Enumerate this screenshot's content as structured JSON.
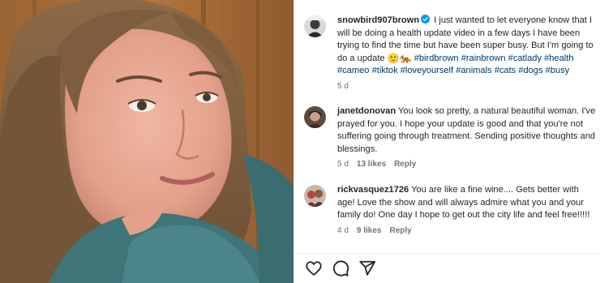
{
  "caption": {
    "username": "snowbird907brown",
    "text": "I just wanted to let everyone know that I will be doing a health update video in a few days I have been trying to find the time but have been super busy. But I'm going to do a update",
    "emojis": [
      "🙂",
      "🐅"
    ],
    "hashtags": [
      "#birdbrown",
      "#rainbrown",
      "#catlady",
      "#health",
      "#cameo",
      "#tiktok",
      "#loveyourself",
      "#animals",
      "#cats",
      "#dogs",
      "#busy"
    ],
    "time": "5 d"
  },
  "comments": [
    {
      "username": "janetdonovan",
      "text": "You look so pretty, a natural beautiful woman. I've prayed for you. I hope your update is good and that you're not suffering going through treatment. Sending positive thoughts and blessings.",
      "time": "5 d",
      "likes": "13 likes",
      "reply": "Reply"
    },
    {
      "username": "rickvasquez1726",
      "text": "You are like a fine wine.... Gets better with age! Love the show and will always admire what you and your family do! One day I hope to get out the city life and feel free!!!!!",
      "time": "4 d",
      "likes": "9 likes",
      "reply": "Reply"
    }
  ],
  "actions": {
    "like_icon": "heart-icon",
    "comment_icon": "comment-icon",
    "share_icon": "share-icon"
  },
  "colors": {
    "hashtag": "#00376b",
    "meta": "#737373",
    "verified": "#0095f6"
  }
}
